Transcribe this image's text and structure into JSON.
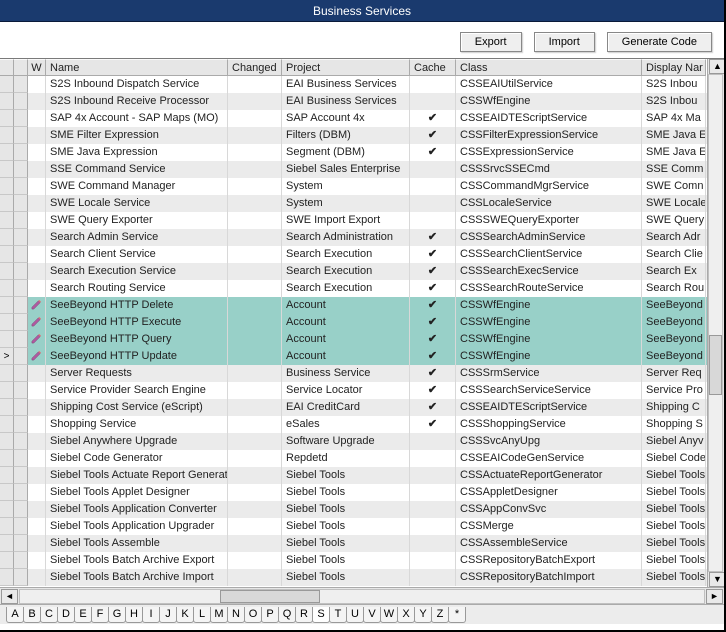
{
  "title": "Business Services",
  "toolbar": {
    "export_label": "Export",
    "import_label": "Import",
    "generate_label": "Generate Code"
  },
  "columns": {
    "w": "W",
    "name": "Name",
    "changed": "Changed",
    "project": "Project",
    "cache": "Cache",
    "class": "Class",
    "display_name": "Display Nar"
  },
  "alpha": {
    "letters": [
      "A",
      "B",
      "C",
      "D",
      "E",
      "F",
      "G",
      "H",
      "I",
      "J",
      "K",
      "L",
      "M",
      "N",
      "O",
      "P",
      "Q",
      "R",
      "S",
      "T",
      "U",
      "V",
      "W",
      "X",
      "Y",
      "Z",
      "*"
    ],
    "active": "S"
  },
  "current_row_index": 15,
  "rows": [
    {
      "w": "",
      "name": "S2S Inbound Dispatch Service",
      "changed": "",
      "project": "EAI Business Services",
      "cache": "",
      "class": "CSSEAIUtilService",
      "disp": "S2S Inbou",
      "hl": false
    },
    {
      "w": "",
      "name": "S2S Inbound Receive Processor",
      "changed": "",
      "project": "EAI Business Services",
      "cache": "",
      "class": "CSSWfEngine",
      "disp": "S2S Inbou",
      "hl": false
    },
    {
      "w": "",
      "name": "SAP 4x Account - SAP Maps (MO)",
      "changed": "",
      "project": "SAP Account 4x",
      "cache": "✔",
      "class": "CSSEAIDTEScriptService",
      "disp": "SAP 4x Ma",
      "hl": false
    },
    {
      "w": "",
      "name": "SME Filter Expression",
      "changed": "",
      "project": "Filters (DBM)",
      "cache": "✔",
      "class": "CSSFilterExpressionService",
      "disp": "SME Java E",
      "hl": false
    },
    {
      "w": "",
      "name": "SME Java Expression",
      "changed": "",
      "project": "Segment (DBM)",
      "cache": "✔",
      "class": "CSSExpressionService",
      "disp": "SME Java E",
      "hl": false
    },
    {
      "w": "",
      "name": "SSE Command Service",
      "changed": "",
      "project": "Siebel Sales Enterprise",
      "cache": "",
      "class": "CSSSrvcSSECmd",
      "disp": "SSE Comm",
      "hl": false
    },
    {
      "w": "",
      "name": "SWE Command Manager",
      "changed": "",
      "project": "System",
      "cache": "",
      "class": "CSSCommandMgrService",
      "disp": "SWE Comn",
      "hl": false
    },
    {
      "w": "",
      "name": "SWE Locale Service",
      "changed": "",
      "project": "System",
      "cache": "",
      "class": "CSSLocaleService",
      "disp": "SWE Locale",
      "hl": false
    },
    {
      "w": "",
      "name": "SWE Query Exporter",
      "changed": "",
      "project": "SWE Import Export",
      "cache": "",
      "class": "CSSSWEQueryExporter",
      "disp": "SWE Query",
      "hl": false
    },
    {
      "w": "",
      "name": "Search Admin Service",
      "changed": "",
      "project": "Search Administration",
      "cache": "✔",
      "class": "CSSSearchAdminService",
      "disp": "Search Adr",
      "hl": false
    },
    {
      "w": "",
      "name": "Search Client Service",
      "changed": "",
      "project": "Search Execution",
      "cache": "✔",
      "class": "CSSSearchClientService",
      "disp": "Search Clie",
      "hl": false
    },
    {
      "w": "",
      "name": "Search Execution Service",
      "changed": "",
      "project": "Search Execution",
      "cache": "✔",
      "class": "CSSSearchExecService",
      "disp": "Search Ex",
      "hl": false
    },
    {
      "w": "",
      "name": "Search Routing Service",
      "changed": "",
      "project": "Search Execution",
      "cache": "✔",
      "class": "CSSSearchRouteService",
      "disp": "Search Rou",
      "hl": false
    },
    {
      "w": "p",
      "name": "SeeBeyond HTTP Delete",
      "changed": "",
      "project": "Account",
      "cache": "✔",
      "class": "CSSWfEngine",
      "disp": "SeeBeyond",
      "hl": true
    },
    {
      "w": "p",
      "name": "SeeBeyond HTTP Execute",
      "changed": "",
      "project": "Account",
      "cache": "✔",
      "class": "CSSWfEngine",
      "disp": "SeeBeyond",
      "hl": true
    },
    {
      "w": "p",
      "name": "SeeBeyond HTTP Query",
      "changed": "",
      "project": "Account",
      "cache": "✔",
      "class": "CSSWfEngine",
      "disp": "SeeBeyond",
      "hl": true
    },
    {
      "w": "p",
      "name": "SeeBeyond HTTP Update",
      "changed": "",
      "project": "Account",
      "cache": "✔",
      "class": "CSSWfEngine",
      "disp": "SeeBeyond",
      "hl": true
    },
    {
      "w": "",
      "name": "Server Requests",
      "changed": "",
      "project": "Business Service",
      "cache": "✔",
      "class": "CSSSrmService",
      "disp": "Server Req",
      "hl": false
    },
    {
      "w": "",
      "name": "Service Provider Search Engine",
      "changed": "",
      "project": "Service Locator",
      "cache": "✔",
      "class": "CSSSearchServiceService",
      "disp": "Service Pro",
      "hl": false
    },
    {
      "w": "",
      "name": "Shipping Cost Service (eScript)",
      "changed": "",
      "project": "EAI CreditCard",
      "cache": "✔",
      "class": "CSSEAIDTEScriptService",
      "disp": "Shipping C",
      "hl": false
    },
    {
      "w": "",
      "name": "Shopping Service",
      "changed": "",
      "project": "eSales",
      "cache": "✔",
      "class": "CSSShoppingService",
      "disp": "Shopping S",
      "hl": false
    },
    {
      "w": "",
      "name": "Siebel Anywhere Upgrade",
      "changed": "",
      "project": "Software Upgrade",
      "cache": "",
      "class": "CSSSvcAnyUpg",
      "disp": "Siebel Anyv",
      "hl": false
    },
    {
      "w": "",
      "name": "Siebel Code Generator",
      "changed": "",
      "project": "Repdetd",
      "cache": "",
      "class": "CSSEAICodeGenService",
      "disp": "Siebel Code",
      "hl": false
    },
    {
      "w": "",
      "name": "Siebel Tools Actuate Report Generator",
      "changed": "",
      "project": "Siebel Tools",
      "cache": "",
      "class": "CSSActuateReportGenerator",
      "disp": "Siebel Tools",
      "hl": false
    },
    {
      "w": "",
      "name": "Siebel Tools Applet Designer",
      "changed": "",
      "project": "Siebel Tools",
      "cache": "",
      "class": "CSSAppletDesigner",
      "disp": "Siebel Tools",
      "hl": false
    },
    {
      "w": "",
      "name": "Siebel Tools Application Converter",
      "changed": "",
      "project": "Siebel Tools",
      "cache": "",
      "class": "CSSAppConvSvc",
      "disp": "Siebel Tools",
      "hl": false
    },
    {
      "w": "",
      "name": "Siebel Tools Application Upgrader",
      "changed": "",
      "project": "Siebel Tools",
      "cache": "",
      "class": "CSSMerge",
      "disp": "Siebel Tools",
      "hl": false
    },
    {
      "w": "",
      "name": "Siebel Tools Assemble",
      "changed": "",
      "project": "Siebel Tools",
      "cache": "",
      "class": "CSSAssembleService",
      "disp": "Siebel Tools",
      "hl": false
    },
    {
      "w": "",
      "name": "Siebel Tools Batch Archive Export",
      "changed": "",
      "project": "Siebel Tools",
      "cache": "",
      "class": "CSSRepositoryBatchExport",
      "disp": "Siebel Tools",
      "hl": false
    },
    {
      "w": "",
      "name": "Siebel Tools Batch Archive Import",
      "changed": "",
      "project": "Siebel Tools",
      "cache": "",
      "class": "CSSRepositoryBatchImport",
      "disp": "Siebel Tools",
      "hl": false
    }
  ]
}
